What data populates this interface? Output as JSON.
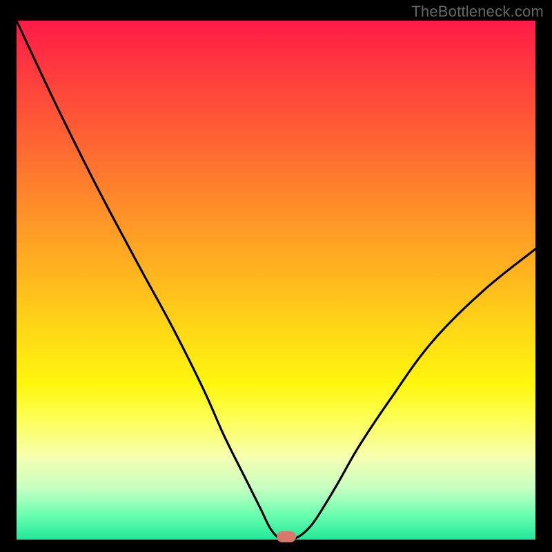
{
  "watermark": "TheBottleneck.com",
  "chart_data": {
    "type": "line",
    "title": "",
    "xlabel": "",
    "ylabel": "",
    "xlim": [
      0,
      100
    ],
    "ylim": [
      0,
      100
    ],
    "grid": false,
    "legend": false,
    "series": [
      {
        "name": "bottleneck-curve",
        "x": [
          0,
          8,
          16,
          24,
          30,
          36,
          40,
          44,
          47,
          49,
          51,
          53,
          55,
          57,
          59,
          62,
          66,
          72,
          80,
          90,
          100
        ],
        "values": [
          100,
          83,
          67,
          52,
          41,
          29,
          20,
          12,
          6,
          2,
          0,
          0,
          1,
          3,
          6,
          11,
          18,
          27,
          38,
          48,
          56
        ]
      }
    ],
    "marker": {
      "x": 52,
      "y": 0.5,
      "color": "#d9776a"
    },
    "background_gradient": {
      "direction": "vertical",
      "stops": [
        {
          "pos": 0.0,
          "color": "#ff1b48"
        },
        {
          "pos": 0.5,
          "color": "#ffb91e"
        },
        {
          "pos": 0.72,
          "color": "#fff70e"
        },
        {
          "pos": 1.0,
          "color": "#22e89a"
        }
      ]
    }
  }
}
